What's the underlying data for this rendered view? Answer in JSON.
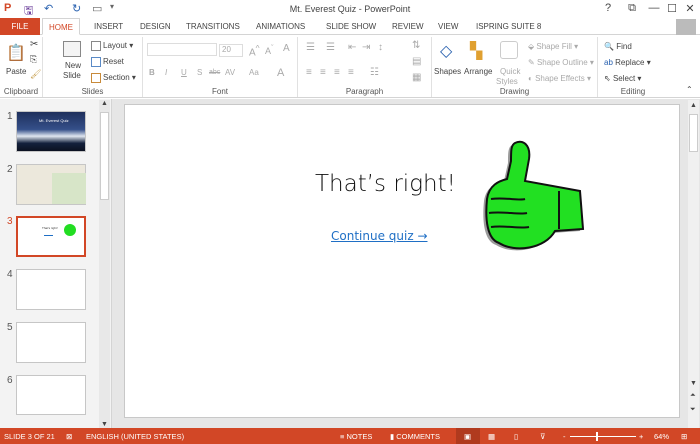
{
  "window": {
    "title": "Mt. Everest Quiz - PowerPoint",
    "help": "?",
    "restore": "⧉",
    "minimize": "—",
    "maximize": "☐",
    "close": "✕"
  },
  "tabs": [
    "FILE",
    "HOME",
    "INSERT",
    "DESIGN",
    "TRANSITIONS",
    "ANIMATIONS",
    "SLIDE SHOW",
    "REVIEW",
    "VIEW",
    "ISPRING SUITE 8"
  ],
  "ribbon": {
    "clipboard": {
      "label": "Clipboard",
      "paste": "Paste"
    },
    "slides": {
      "label": "Slides",
      "new_slide": "New",
      "new_slide2": "Slide",
      "layout": "Layout",
      "reset": "Reset",
      "section": "Section"
    },
    "font": {
      "label": "Font",
      "font_name": "",
      "font_size": "20",
      "bold": "B",
      "italic": "I",
      "underline": "U",
      "shadow": "S",
      "strike": "abc",
      "spacing": "AV",
      "case": "Aa",
      "color": "A"
    },
    "paragraph": {
      "label": "Paragraph"
    },
    "drawing": {
      "label": "Drawing",
      "shapes": "Shapes",
      "arrange": "Arrange",
      "quick_styles": "Quick",
      "quick_styles2": "Styles",
      "shape_fill": "Shape Fill",
      "shape_outline": "Shape Outline",
      "shape_effects": "Shape Effects"
    },
    "editing": {
      "label": "Editing",
      "find": "Find",
      "replace": "Replace",
      "select": "Select"
    }
  },
  "thumbnails": [
    {
      "num": "1",
      "text": "Mt. Everest Quiz"
    },
    {
      "num": "2",
      "text": ""
    },
    {
      "num": "3",
      "text": "That's right!"
    },
    {
      "num": "4"
    },
    {
      "num": "5"
    },
    {
      "num": "6"
    }
  ],
  "slide": {
    "heading": "That’s right!",
    "link": "Continue quiz →"
  },
  "status": {
    "slide": "SLIDE 3 OF 21",
    "language": "ENGLISH (UNITED STATES)",
    "notes": "NOTES",
    "comments": "COMMENTS",
    "zoom": "64%",
    "zoom_fraction": 0.4
  },
  "colors": {
    "accent": "#d24726",
    "link": "#1f6fc5",
    "thumb_green": "#22dd22"
  }
}
